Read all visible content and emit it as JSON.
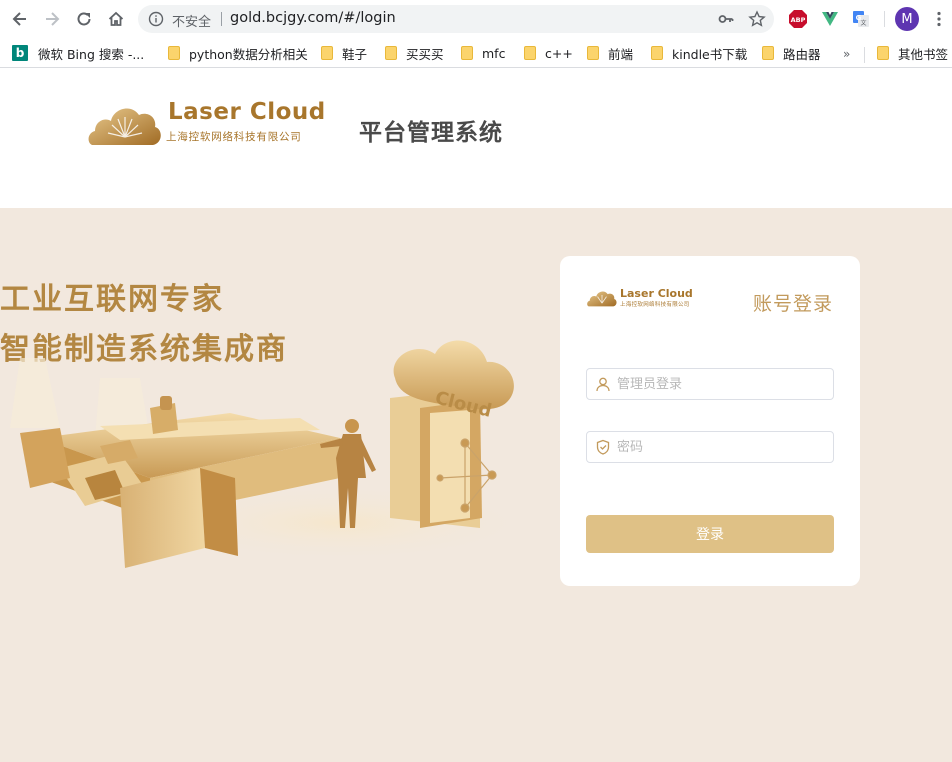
{
  "browser": {
    "security_label": "不安全",
    "url": "gold.bcjgy.com/#/login",
    "profile_initial": "M",
    "bookmarks": [
      {
        "label": "微软 Bing 搜索 -...",
        "icon": "bing-icon"
      },
      {
        "label": "python数据分析相关",
        "icon": "folder-icon"
      },
      {
        "label": "鞋子",
        "icon": "folder-icon"
      },
      {
        "label": "买买买",
        "icon": "folder-icon"
      },
      {
        "label": "mfc",
        "icon": "folder-icon"
      },
      {
        "label": "c++",
        "icon": "folder-icon"
      },
      {
        "label": "前端",
        "icon": "folder-icon"
      },
      {
        "label": "kindle书下载",
        "icon": "folder-icon"
      },
      {
        "label": "路由器",
        "icon": "folder-icon"
      }
    ],
    "bookmarks_more": "»",
    "other_bookmarks": "其他书签",
    "extensions": [
      "abp-icon",
      "vue-devtools-icon",
      "google-translate-icon"
    ],
    "abp_label": "ABP"
  },
  "header": {
    "brand_en": "Laser Cloud",
    "brand_cn": "上海控软网络科技有限公司",
    "title": "平台管理系统"
  },
  "hero": {
    "slogan_line1": "工业互联网专家",
    "slogan_line2": "智能制造系统集成商",
    "cloud_label": "Cloud"
  },
  "login": {
    "logo_en": "Laser Cloud",
    "logo_cn": "上海控软网络科技有限公司",
    "title": "账号登录",
    "username_placeholder": "管理员登录",
    "username_value": "",
    "password_placeholder": "密码",
    "password_value": "",
    "submit_label": "登录"
  },
  "colors": {
    "brand_gold": "#b38742",
    "hero_bg": "#f2e8de",
    "button_bg": "#dfc186"
  }
}
